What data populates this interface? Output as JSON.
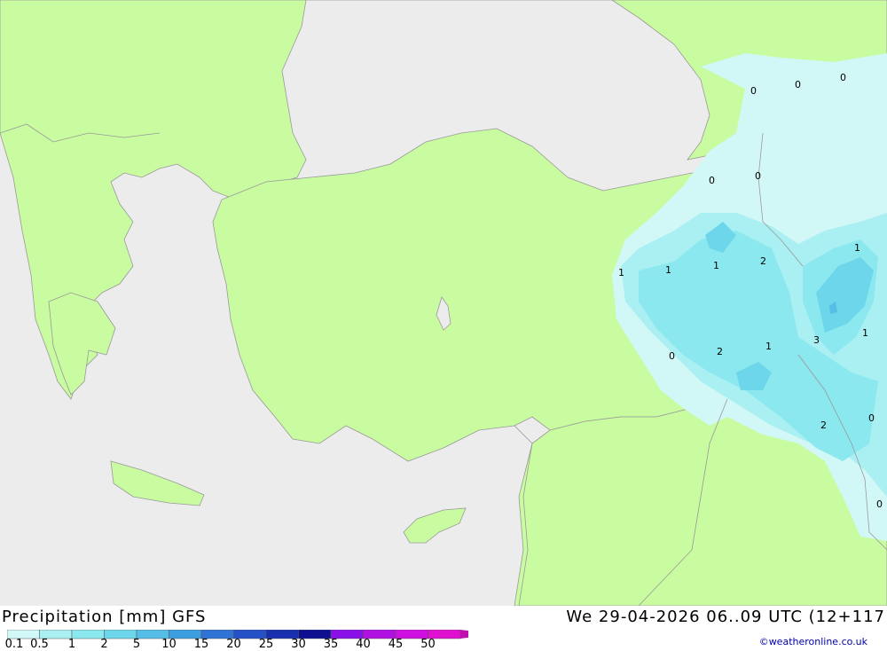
{
  "header": {
    "title": "Precipitation [mm] GFS",
    "datetime": "We 29-04-2026 06..09 UTC (12+117",
    "credit": "©weatheronline.co.uk"
  },
  "legend": {
    "ticks": [
      "0.1",
      "0.5",
      "1",
      "2",
      "5",
      "10",
      "15",
      "20",
      "25",
      "30",
      "35",
      "40",
      "45",
      "50"
    ],
    "colors": [
      "#d2f7f7",
      "#aaf0f2",
      "#8ae8ee",
      "#6dd6ea",
      "#55bde6",
      "#3d9ee0",
      "#2f73d6",
      "#2450c8",
      "#1830b0",
      "#0c1090",
      "#8a10e8",
      "#b010e0",
      "#d010e0",
      "#e010d0",
      "#c010b0"
    ]
  },
  "map": {
    "colors": {
      "sea": "#ececec",
      "land": "#c9fca0",
      "border": "#999999",
      "precip_light": "#d2f7f7",
      "precip_mid": "#aaf0f2",
      "precip_1": "#8ae8ee",
      "precip_2": "#6dd6ea",
      "precip_5": "#55bde6"
    },
    "values": [
      "0",
      "0",
      "0",
      "0",
      "0",
      "1",
      "1",
      "1",
      "2",
      "1",
      "1",
      "3",
      "1",
      "0",
      "2",
      "1",
      "2",
      "0",
      "0"
    ]
  }
}
